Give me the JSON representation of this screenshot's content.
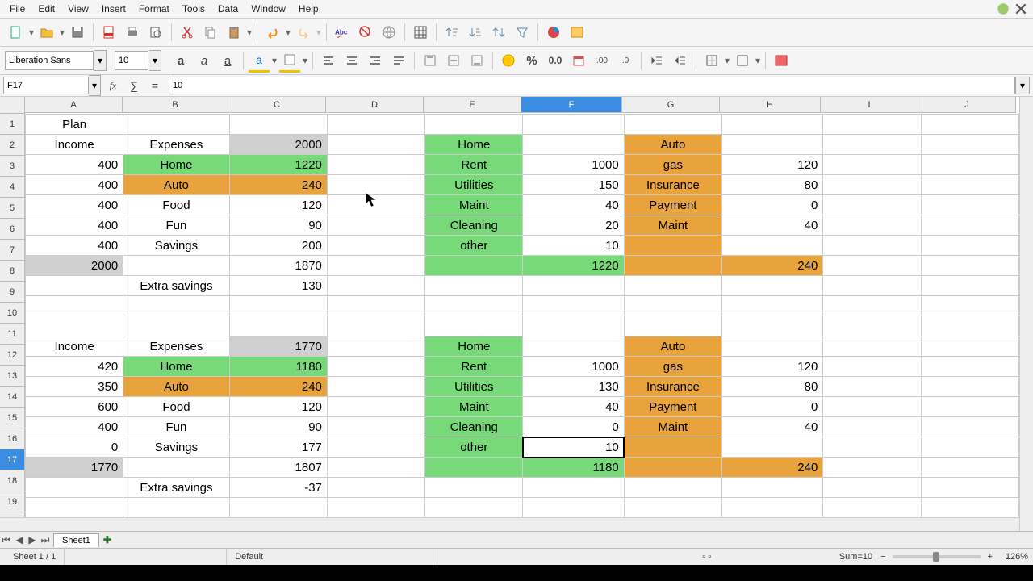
{
  "menu": {
    "file": "File",
    "edit": "Edit",
    "view": "View",
    "insert": "Insert",
    "format": "Format",
    "tools": "Tools",
    "data": "Data",
    "window": "Window",
    "help": "Help"
  },
  "font": {
    "name": "Liberation Sans",
    "size": "10"
  },
  "namebox": "F17",
  "formula": "10",
  "columns": [
    "A",
    "B",
    "C",
    "D",
    "E",
    "F",
    "G",
    "H",
    "I",
    "J"
  ],
  "selected_col": "F",
  "selected_row": 17,
  "cells": {
    "A1": "Plan",
    "A2": "Income",
    "B2": "Expenses",
    "C2": "2000",
    "E2": "Home",
    "G2": "Auto",
    "A3": "400",
    "B3": "Home",
    "C3": "1220",
    "E3": "Rent",
    "F3": "1000",
    "G3": "gas",
    "H3": "120",
    "A4": "400",
    "B4": "Auto",
    "C4": "240",
    "E4": "Utilities",
    "F4": "150",
    "G4": "Insurance",
    "H4": "80",
    "A5": "400",
    "B5": "Food",
    "C5": "120",
    "E5": "Maint",
    "F5": "40",
    "G5": "Payment",
    "H5": "0",
    "A6": "400",
    "B6": "Fun",
    "C6": "90",
    "E6": "Cleaning",
    "F6": "20",
    "G6": "Maint",
    "H6": "40",
    "A7": "400",
    "B7": "Savings",
    "C7": "200",
    "E7": "other",
    "F7": "10",
    "A8": "2000",
    "C8": "1870",
    "F8": "1220",
    "H8": "240",
    "B9": "Extra savings",
    "C9": "130",
    "A12": "Income",
    "B12": "Expenses",
    "C12": "1770",
    "E12": "Home",
    "G12": "Auto",
    "A13": "420",
    "B13": "Home",
    "C13": "1180",
    "E13": "Rent",
    "F13": "1000",
    "G13": "gas",
    "H13": "120",
    "A14": "350",
    "B14": "Auto",
    "C14": "240",
    "E14": "Utilities",
    "F14": "130",
    "G14": "Insurance",
    "H14": "80",
    "A15": "600",
    "B15": "Food",
    "C15": "120",
    "E15": "Maint",
    "F15": "40",
    "G15": "Payment",
    "H15": "0",
    "A16": "400",
    "B16": "Fun",
    "C16": "90",
    "E16": "Cleaning",
    "F16": "0",
    "G16": "Maint",
    "H16": "40",
    "A17": "0",
    "B17": "Savings",
    "C17": "177",
    "E17": "other",
    "F17": "10",
    "A18": "1770",
    "C18": "1807",
    "F18": "1180",
    "H18": "240",
    "B19": "Extra savings",
    "C19": "-37"
  },
  "sheettab": "Sheet1",
  "status": {
    "sheet": "Sheet 1 / 1",
    "style": "Default",
    "sum": "Sum=10",
    "zoom": "126%"
  }
}
